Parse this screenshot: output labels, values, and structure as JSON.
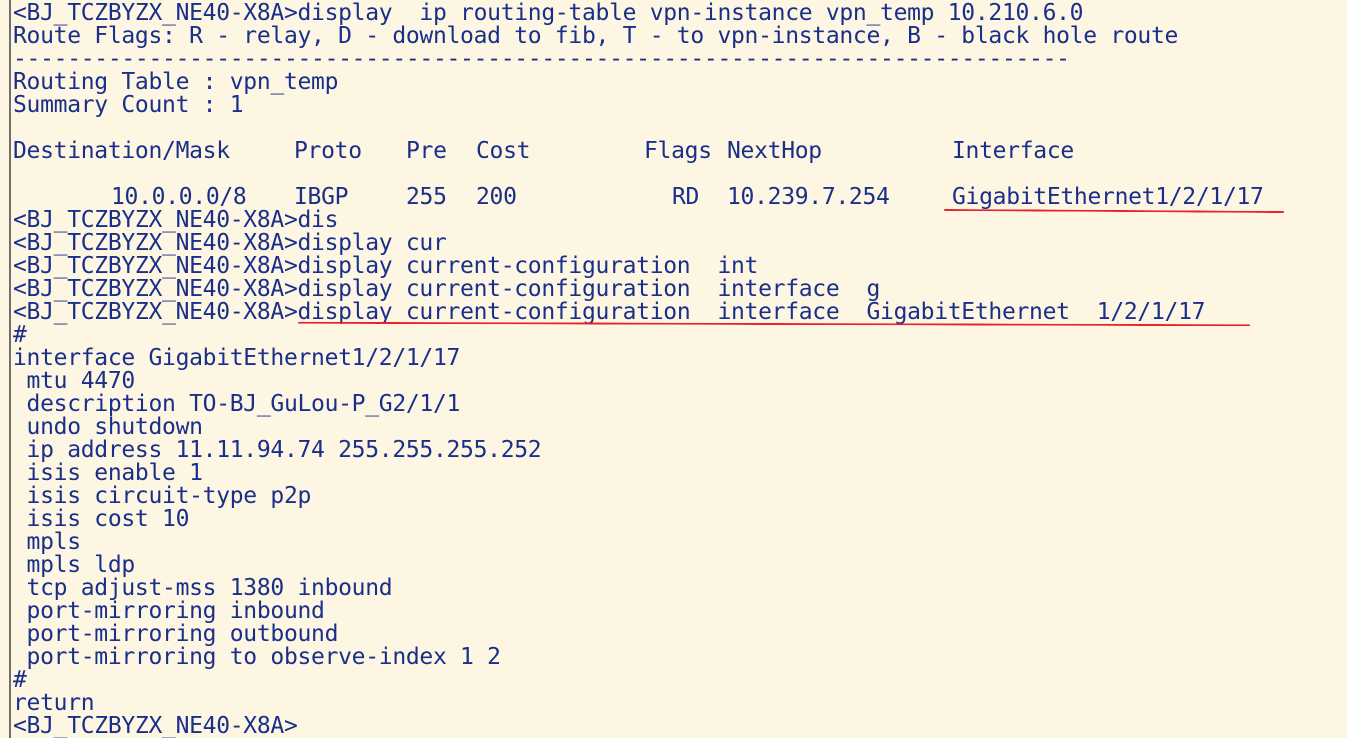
{
  "terminal": {
    "lines": [
      "<BJ_TCZBYZX_NE40-X8A>display  ip routing-table vpn-instance vpn_temp 10.210.6.0",
      "Route Flags: R - relay, D - download to fib, T - to vpn-instance, B - black hole route",
      "------------------------------------------------------------------------------",
      "Routing Table : vpn_temp",
      "Summary Count : 1",
      ""
    ],
    "table_header": {
      "destination": "Destination/Mask",
      "proto": "Proto",
      "pre": "Pre",
      "cost": "Cost",
      "flags": "Flags",
      "nexthop": "NextHop",
      "interface": "Interface"
    },
    "route_row": {
      "destination": "10.0.0.0/8",
      "proto": "IBGP",
      "pre": "255",
      "cost": "200",
      "flags": "RD",
      "nexthop": "10.239.7.254",
      "interface": "GigabitEthernet1/2/1/17"
    },
    "commands": [
      "<BJ_TCZBYZX_NE40-X8A>dis",
      "<BJ_TCZBYZX_NE40-X8A>display cur",
      "<BJ_TCZBYZX_NE40-X8A>display current-configuration  int",
      "<BJ_TCZBYZX_NE40-X8A>display current-configuration  interface  g"
    ],
    "highlighted_command": {
      "prompt": "<BJ_TCZBYZX_NE40-X8A>",
      "command": "display current-configuration  interface  GigabitEthernet  1/2/1/17"
    },
    "config_lines": [
      "#",
      "interface GigabitEthernet1/2/1/17",
      " mtu 4470",
      " description TO-BJ_GuLou-P_G2/1/1",
      " undo shutdown",
      " ip address 11.11.94.74 255.255.255.252",
      " isis enable 1",
      " isis circuit-type p2p",
      " isis cost 10",
      " mpls",
      " mpls ldp",
      " tcp adjust-mss 1380 inbound",
      " port-mirroring inbound",
      " port-mirroring outbound",
      " port-mirroring to observe-index 1 2",
      "#",
      "return",
      "<BJ_TCZBYZX_NE40-X8A>"
    ],
    "colors": {
      "background": "#fdf6e3",
      "text": "#1a2f8a",
      "annotation": "#e8232b"
    }
  }
}
